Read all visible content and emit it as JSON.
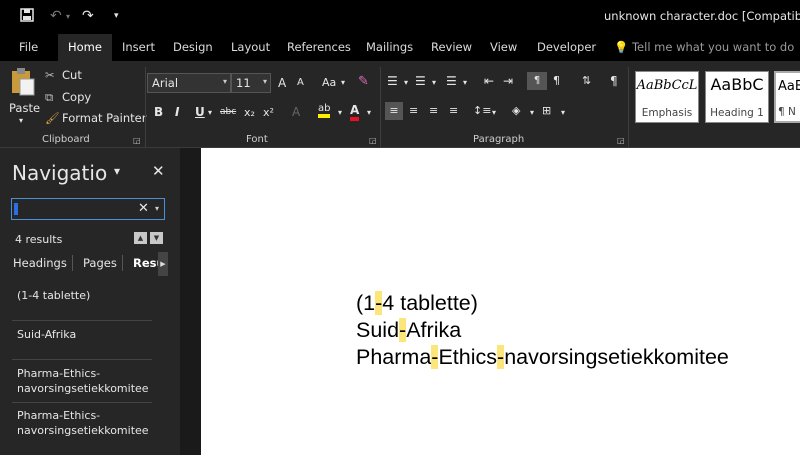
{
  "titlebar": {
    "title": "unknown character.doc [Compatibility",
    "save_icon": "save-icon",
    "undo_icon": "undo-icon",
    "redo_icon": "redo-icon",
    "customize_icon": "customize-qat-icon"
  },
  "tabs": [
    "File",
    "Home",
    "Insert",
    "Design",
    "Layout",
    "References",
    "Mailings",
    "Review",
    "View",
    "Developer"
  ],
  "tell_me": "Tell me what you want to do",
  "ribbon": {
    "clipboard": {
      "label": "Clipboard",
      "paste": "Paste",
      "cut": "Cut",
      "copy": "Copy",
      "format_painter": "Format Painter"
    },
    "font": {
      "label": "Font",
      "font_name": "Arial",
      "font_size": "11",
      "grow": "A",
      "shrink": "A",
      "change_case": "Aa",
      "bold": "B",
      "italic": "I",
      "underline": "U",
      "strikethrough": "abc",
      "subscript": "x₂",
      "superscript": "x²",
      "text_effects": "A",
      "highlight": "ab",
      "font_color": "A",
      "highlight_color": "#ffef00",
      "font_color_value": "#e81123"
    },
    "paragraph": {
      "label": "Paragraph"
    },
    "styles": [
      {
        "sample": "AaBbCcL",
        "name": "Emphasis"
      },
      {
        "sample": "AaBbC",
        "name": "Heading 1"
      },
      {
        "sample": "AaB",
        "name": "¶ N"
      }
    ]
  },
  "navigation": {
    "title": "Navigation",
    "search_value": "",
    "results_count": "4 results",
    "tabs": [
      "Headings",
      "Pages",
      "Results"
    ],
    "results": [
      "(1-4 tablette)",
      "Suid-Afrika",
      "Pharma-Ethics-navorsingsetiekkomitee",
      "Pharma-Ethics-navorsingsetiekkomitee"
    ]
  },
  "document": {
    "line1": {
      "a": "(1",
      "hl1": "-",
      "b": "4 tablette)"
    },
    "line2": {
      "a": "Suid",
      "hl1": "-",
      "b": "Afrika"
    },
    "line3": {
      "a": "Pharma",
      "hl1": "-",
      "b": "Ethics",
      "hl2": "-",
      "c": "navorsingsetiekkomitee"
    },
    "highlight_color": "#fce67a"
  }
}
